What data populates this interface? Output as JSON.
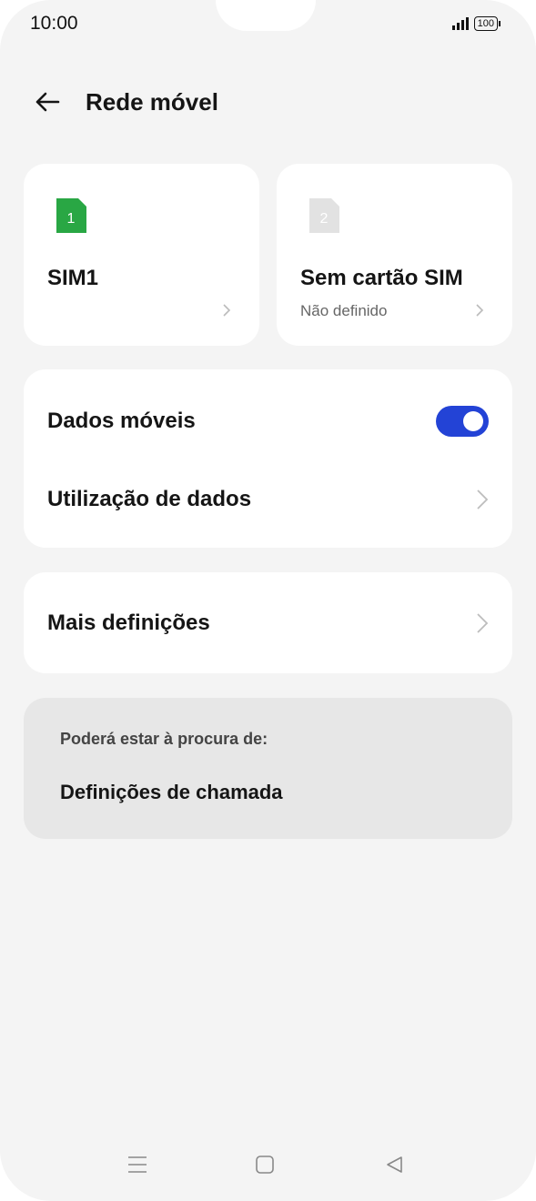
{
  "status": {
    "time": "10:00",
    "battery": "100"
  },
  "header": {
    "title": "Rede móvel"
  },
  "sims": [
    {
      "slot": "1",
      "name": "SIM1",
      "subtitle": ""
    },
    {
      "slot": "2",
      "name": "Sem cartão SIM",
      "subtitle": "Não definido"
    }
  ],
  "data_section": {
    "mobile_data_label": "Dados móveis",
    "mobile_data_enabled": true,
    "usage_label": "Utilização de dados"
  },
  "more": {
    "label": "Mais definições"
  },
  "suggestions": {
    "label": "Poderá estar à procura de:",
    "item": "Definições de chamada"
  },
  "colors": {
    "accent": "#2343d6",
    "sim_active": "#29a744",
    "sim_inactive": "#e2e2e2"
  },
  "nav": {
    "icons": [
      "menu-icon",
      "home-icon",
      "back-triangle-icon"
    ]
  }
}
